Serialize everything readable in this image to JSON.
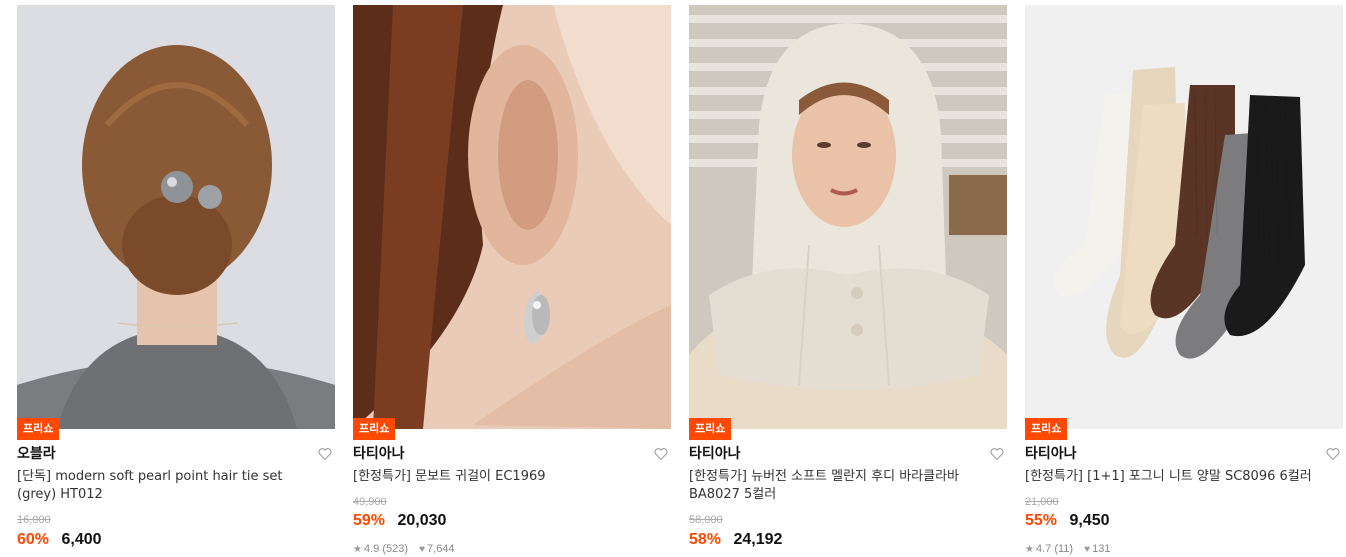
{
  "products": [
    {
      "badge": "프리쇼",
      "brand": "오블라",
      "name": "[단독] modern soft pearl point hair tie set (grey) HT012",
      "original_price": "16,000",
      "discount": "60%",
      "price": "6,400",
      "rating": "",
      "reviews": "",
      "likes": ""
    },
    {
      "badge": "프리쇼",
      "brand": "타티아나",
      "name": "[한정특가] 문보트 귀걸이 EC1969",
      "original_price": "49,900",
      "discount": "59%",
      "price": "20,030",
      "rating": "4.9",
      "reviews": "(523)",
      "likes": "7,644"
    },
    {
      "badge": "프리쇼",
      "brand": "타티아나",
      "name": "[한정특가] 뉴버전 소프트 멜란지 후디 바라클라바 BA8027 5컬러",
      "original_price": "58,000",
      "discount": "58%",
      "price": "24,192",
      "rating": "",
      "reviews": "",
      "likes": ""
    },
    {
      "badge": "프리쇼",
      "brand": "타티아나",
      "name": "[한정특가] [1+1] 포그니 니트 양말 SC8096 6컬러",
      "original_price": "21,000",
      "discount": "55%",
      "price": "9,450",
      "rating": "4.7",
      "reviews": "(11)",
      "likes": "131"
    }
  ],
  "colors": {
    "accent": "#ff4800",
    "text": "#111111",
    "muted": "#aaaaaa"
  },
  "icons": {
    "wishlist": "heart-outline-icon",
    "rating": "star-icon",
    "likes": "heart-filled-icon"
  }
}
